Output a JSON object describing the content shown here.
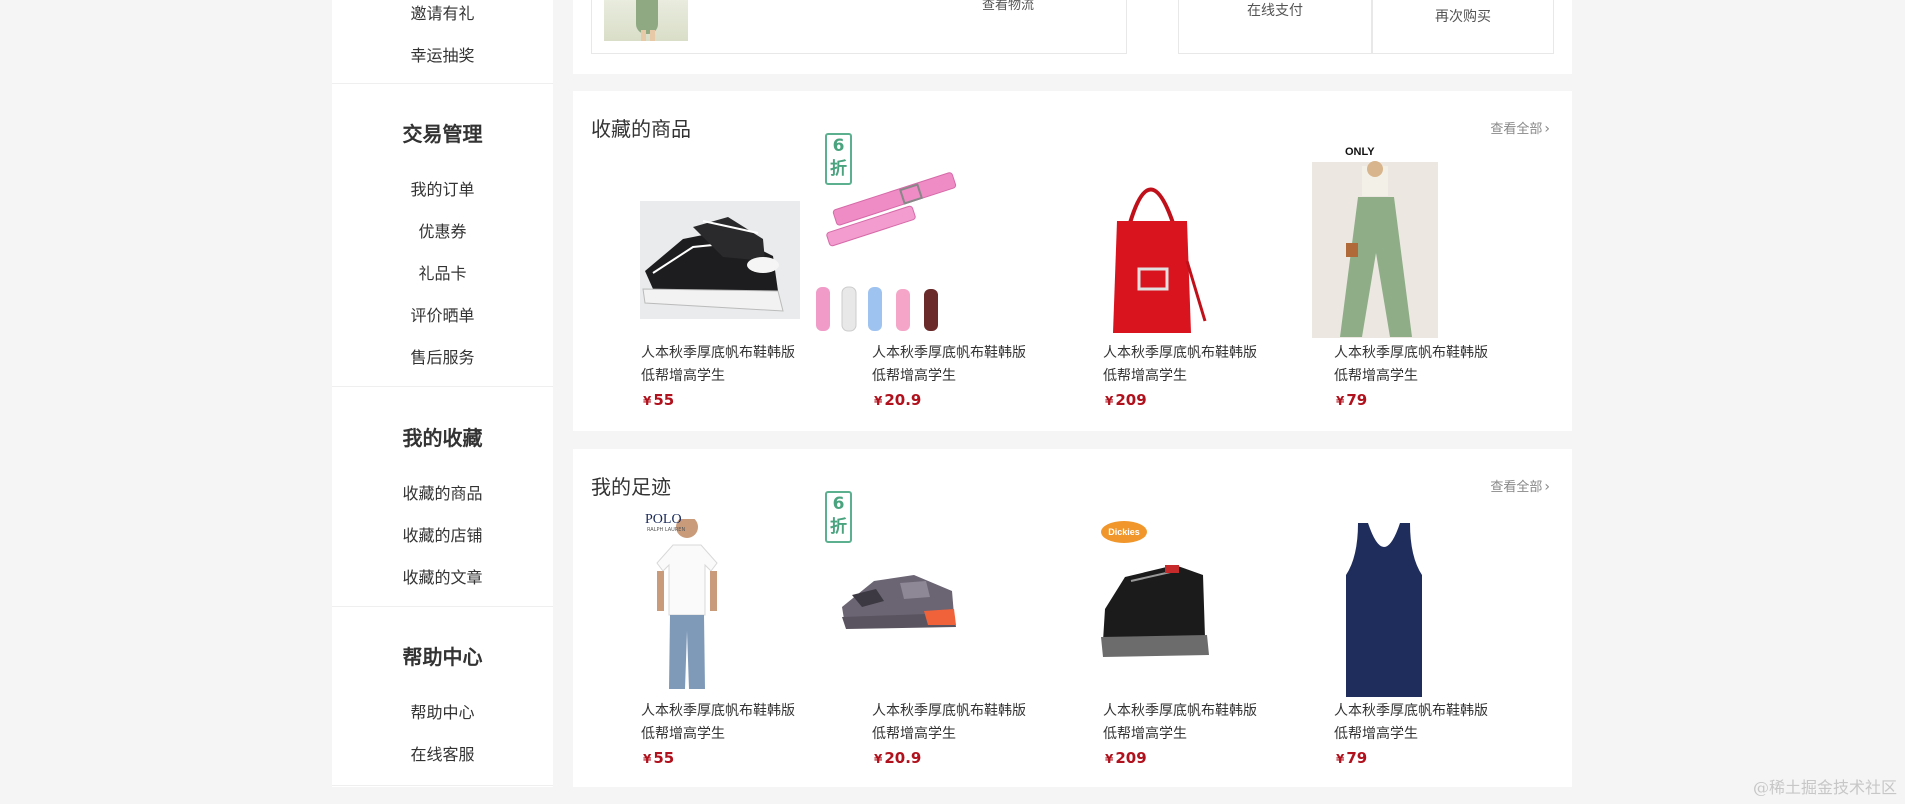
{
  "sidebar": {
    "top_items": [
      "邀请有礼",
      "幸运抽奖"
    ],
    "sections": [
      {
        "title": "交易管理",
        "items": [
          "我的订单",
          "优惠券",
          "礼品卡",
          "评价晒单",
          "售后服务"
        ]
      },
      {
        "title": "我的收藏",
        "items": [
          "收藏的商品",
          "收藏的店铺",
          "收藏的文章"
        ]
      },
      {
        "title": "帮助中心",
        "items": [
          "帮助中心",
          "在线客服"
        ]
      }
    ]
  },
  "order": {
    "meta": "查看物流",
    "pay_label": "在线支付",
    "rebuy_label": "再次购买"
  },
  "favorites": {
    "title": "收藏的商品",
    "view_all": "查看全部",
    "discount_badge": "6折",
    "products": [
      {
        "name": "人本秋季厚底帆布鞋韩版低帮增高学生",
        "currency": "¥",
        "price": "55",
        "image": "canvas-platform-sneaker"
      },
      {
        "name": "人本秋季厚底帆布鞋韩版低帮增高学生",
        "currency": "¥",
        "price": "20.9",
        "image": "leather-watch-straps"
      },
      {
        "name": "人本秋季厚底帆布鞋韩版低帮增高学生",
        "currency": "¥",
        "price": "209",
        "image": "red-handbag"
      },
      {
        "name": "人本秋季厚底帆布鞋韩版低帮增高学生",
        "currency": "¥",
        "price": "79",
        "image": "green-wide-pants",
        "brand": "ONLY"
      }
    ]
  },
  "footprints": {
    "title": "我的足迹",
    "view_all": "查看全部",
    "discount_badge": "6折",
    "products": [
      {
        "name": "人本秋季厚底帆布鞋韩版低帮增高学生",
        "currency": "¥",
        "price": "55",
        "image": "white-tshirt-model",
        "brand": "POLO",
        "brand_sub": "RALPH LAUREN"
      },
      {
        "name": "人本秋季厚底帆布鞋韩版低帮增高学生",
        "currency": "¥",
        "price": "20.9",
        "image": "camo-running-shoe"
      },
      {
        "name": "人本秋季厚底帆布鞋韩版低帮增高学生",
        "currency": "¥",
        "price": "209",
        "image": "black-work-boot",
        "brand": "Dickies"
      },
      {
        "name": "人本秋季厚底帆布鞋韩版低帮增高学生",
        "currency": "¥",
        "price": "79",
        "image": "navy-tank-top"
      }
    ]
  },
  "watermark": "@稀土掘金技术社区",
  "colors": {
    "price": "#b0111c",
    "discount": "#4aa37f",
    "background": "#f5f5f5"
  }
}
